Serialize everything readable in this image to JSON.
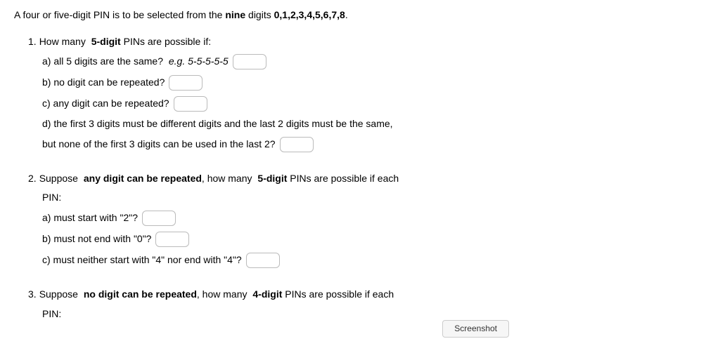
{
  "intro": {
    "pre": "A four or five-digit PIN is to be selected from the ",
    "bold1": "nine",
    "mid": " digits ",
    "bold2": "0,1,2,3,4,5,6,7,8",
    "post": "."
  },
  "q1": {
    "num": "1.",
    "lead_pre": "How many ",
    "lead_bold": "5-digit",
    "lead_post": " PINs are possible if:",
    "a_pre": "a) all 5 digits are the same? ",
    "a_em": "e.g. 5-5-5-5-5",
    "b": "b) no digit can be repeated?",
    "c": "c) any digit can be repeated?",
    "d1": "d) the first 3 digits must be different digits and the last 2 digits must be the same,",
    "d2": "but none of the first 3 digits can be used in the last 2?"
  },
  "q2": {
    "num": "2.",
    "lead_pre": "Suppose ",
    "lead_bold1": "any digit can be repeated",
    "lead_mid": ", how many ",
    "lead_bold2": "5-digit",
    "lead_post": " PINs are possible if each",
    "lead_line2": "PIN:",
    "a": "a) must start with \"2\"?",
    "b": "b) must not end with \"0\"?",
    "c": "c) must neither start with \"4\" nor end with \"4\"?"
  },
  "q3": {
    "num": "3.",
    "lead_pre": "Suppose ",
    "lead_bold1": "no digit can be repeated",
    "lead_mid": ", how many ",
    "lead_bold2": "4-digit",
    "lead_post": " PINs are possible if each",
    "lead_line2": "PIN:"
  },
  "badge": "Screenshot"
}
